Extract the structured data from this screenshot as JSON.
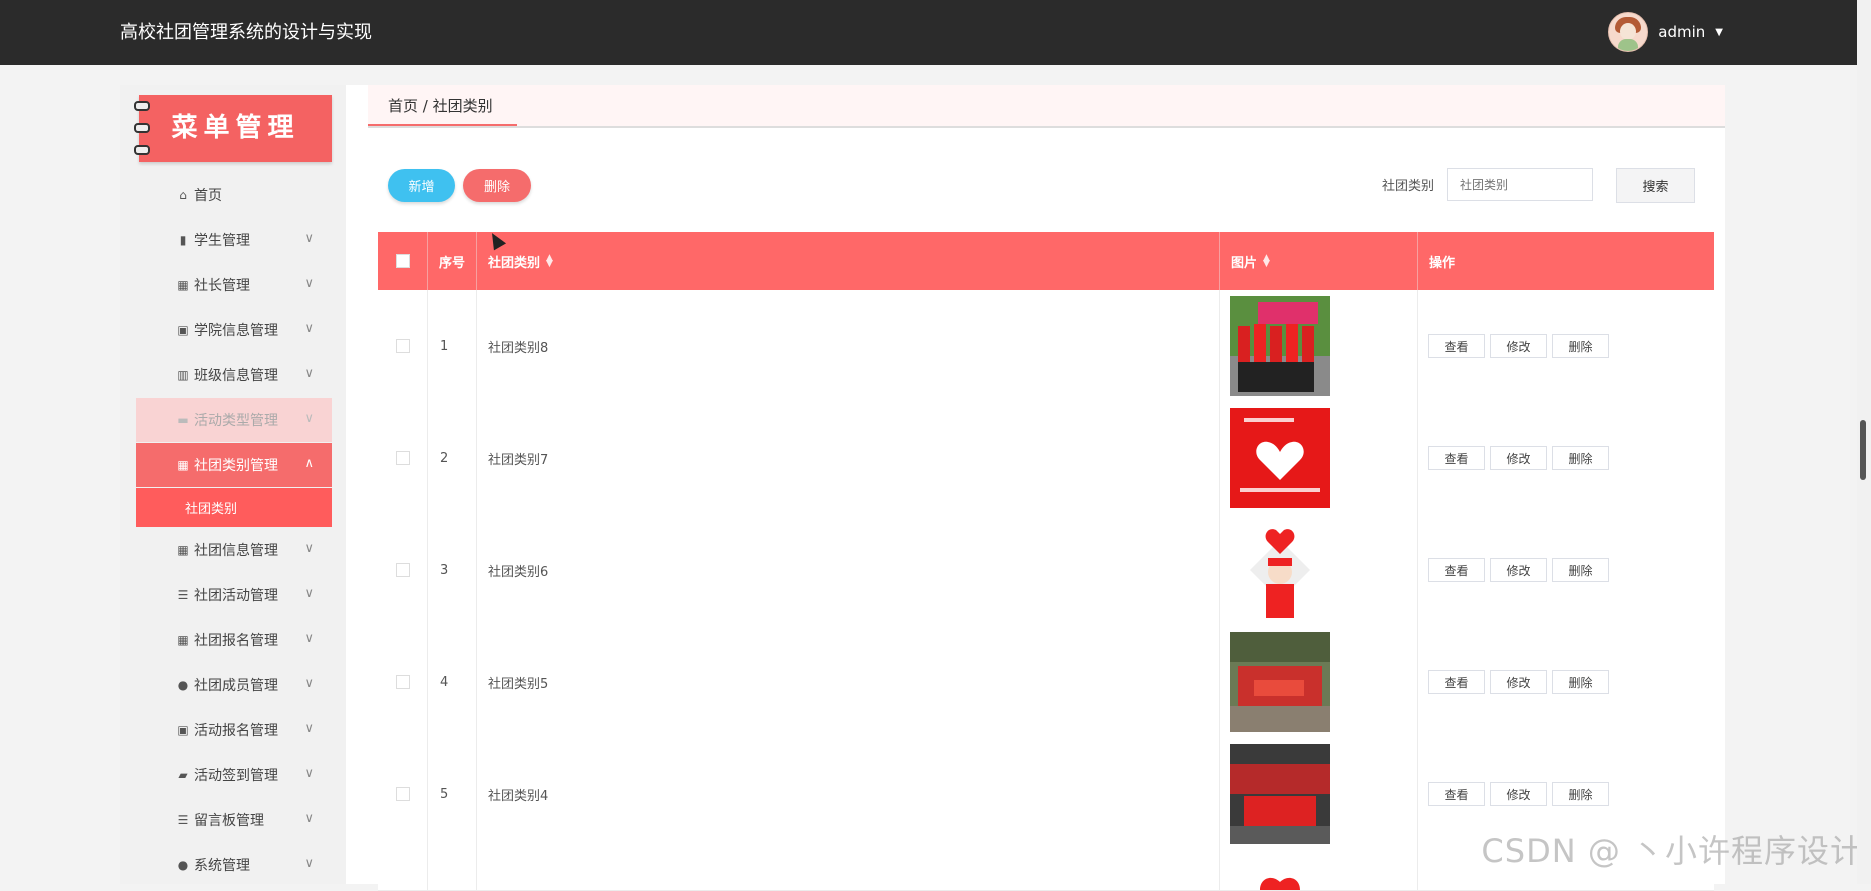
{
  "header": {
    "title": "高校社团管理系统的设计与实现",
    "user": "admin"
  },
  "sidebar": {
    "banner": "菜单管理",
    "items": [
      {
        "label": "首页",
        "icon": "home-icon"
      },
      {
        "label": "学生管理",
        "icon": "bar-chart-icon"
      },
      {
        "label": "社长管理",
        "icon": "grid-icon"
      },
      {
        "label": "学院信息管理",
        "icon": "clipboard-icon"
      },
      {
        "label": "班级信息管理",
        "icon": "library-icon"
      },
      {
        "label": "活动类型管理",
        "icon": "briefcase-icon"
      },
      {
        "label": "社团类别管理",
        "icon": "grid-icon"
      },
      {
        "label": "社团信息管理",
        "icon": "grid-icon"
      },
      {
        "label": "社团活动管理",
        "icon": "list-icon"
      },
      {
        "label": "社团报名管理",
        "icon": "grid-icon"
      },
      {
        "label": "社团成员管理",
        "icon": "user-icon"
      },
      {
        "label": "活动报名管理",
        "icon": "clipboard-check-icon"
      },
      {
        "label": "活动签到管理",
        "icon": "ticket-icon"
      },
      {
        "label": "留言板管理",
        "icon": "list-icon"
      },
      {
        "label": "系统管理",
        "icon": "user-icon"
      }
    ],
    "sub_item": "社团类别"
  },
  "breadcrumb": {
    "text": "首页 / 社团类别"
  },
  "toolbar": {
    "add": "新增",
    "delete": "删除",
    "search_label": "社团类别",
    "search_placeholder": "社团类别",
    "search_button": "搜索"
  },
  "table": {
    "columns": [
      "序号",
      "社团类别",
      "图片",
      "操作"
    ],
    "rows": [
      {
        "no": "1",
        "category": "社团类别8"
      },
      {
        "no": "2",
        "category": "社团类别7"
      },
      {
        "no": "3",
        "category": "社团类别6"
      },
      {
        "no": "4",
        "category": "社团类别5"
      },
      {
        "no": "5",
        "category": "社团类别4"
      }
    ],
    "actions": {
      "view": "查看",
      "edit": "修改",
      "delete": "删除"
    }
  },
  "watermark": "CSDN @ 丶小许程序设计",
  "colors": {
    "accent": "#ff6868",
    "add_button": "#3fc1f0",
    "topbar": "#2b2b2b"
  }
}
